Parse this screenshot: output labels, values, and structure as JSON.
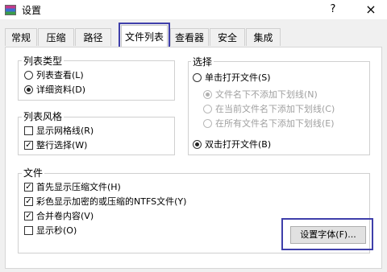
{
  "window": {
    "title": "设置",
    "help": "?",
    "close": "×"
  },
  "tabs": [
    "常规",
    "压缩",
    "路径",
    "文件列表",
    "查看器",
    "安全",
    "集成"
  ],
  "list_type": {
    "title": "列表类型",
    "options": [
      "列表查看(L)",
      "详细资料(D)"
    ]
  },
  "list_style": {
    "title": "列表风格",
    "options": [
      "显示网格线(R)",
      "整行选择(W)"
    ]
  },
  "select": {
    "title": "选择",
    "single": "单击打开文件(S)",
    "sub": [
      "文件名下不添加下划线(N)",
      "在当前文件名下添加下划线(C)",
      "在所有文件名下添加下划线(E)"
    ],
    "double": "双击打开文件(B)"
  },
  "file": {
    "title": "文件",
    "options": [
      "首先显示压缩文件(H)",
      "彩色显示加密的或压缩的NTFS文件(Y)",
      "合并卷内容(V)",
      "显示秒(O)"
    ],
    "set_font": "设置字体(F)..."
  }
}
